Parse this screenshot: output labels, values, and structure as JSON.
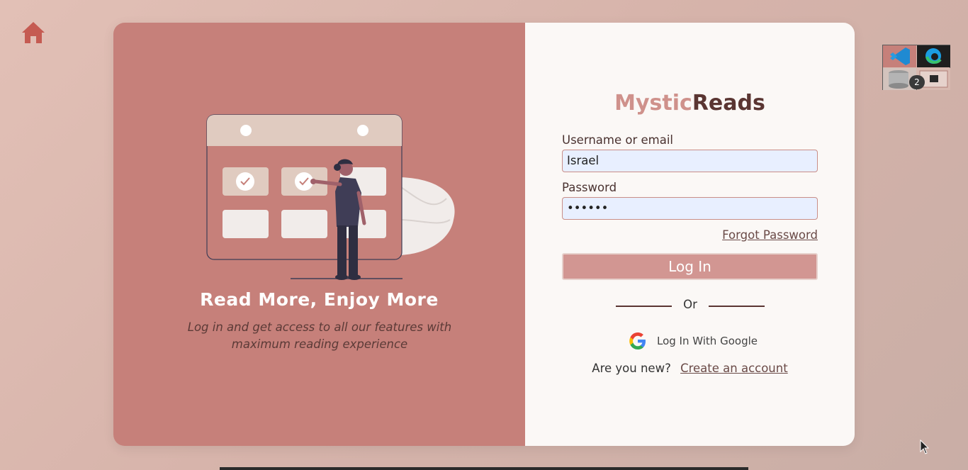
{
  "home": {
    "icon": "home-icon"
  },
  "hero": {
    "title": "Read More, Enjoy More",
    "subtitle": "Log in and get access to all our features with maximum reading experience"
  },
  "brand": {
    "part1": "Mystic",
    "part2": "Reads"
  },
  "form": {
    "username_label": "Username or email",
    "username_value": "Israel",
    "password_label": "Password",
    "password_value": "••••••",
    "forgot_label": "Forgot Password",
    "login_label": "Log In",
    "or_label": "Or",
    "google_label": "Log In With Google",
    "new_prompt": "Are you new?",
    "create_label": "Create an account"
  },
  "taskbar": {
    "badge_count": "2"
  },
  "colors": {
    "panel": "#c6807a",
    "brand_light": "#cf918b",
    "brand_dark": "#5a3532",
    "button": "#d29692"
  }
}
